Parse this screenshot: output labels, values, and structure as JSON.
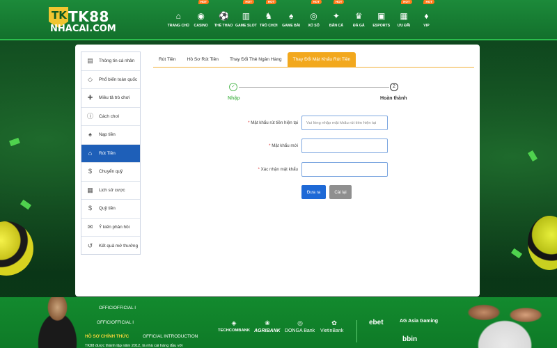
{
  "header": {
    "logo_badge": "TK",
    "logo_brand": "TK88",
    "logo_site": "NHACAI.COM",
    "hot_badge": "HOT",
    "nav": [
      {
        "label": "TRANG CHỦ",
        "icon": "home-icon",
        "hot": false
      },
      {
        "label": "CASINO",
        "icon": "casino-chip-icon",
        "hot": true
      },
      {
        "label": "THỂ THAO",
        "icon": "soccer-ball-icon",
        "hot": false
      },
      {
        "label": "GAME SLOT",
        "icon": "slot-machine-icon",
        "hot": true
      },
      {
        "label": "TRÒ CHƠI",
        "icon": "chess-icon",
        "hot": true
      },
      {
        "label": "GAME BÀI",
        "icon": "cards-icon",
        "hot": false
      },
      {
        "label": "XỔ SỐ",
        "icon": "lottery-ball-icon",
        "hot": true
      },
      {
        "label": "BẮN CÁ",
        "icon": "fish-icon",
        "hot": true
      },
      {
        "label": "ĐÁ GÀ",
        "icon": "rooster-icon",
        "hot": false
      },
      {
        "label": "ESPORTS",
        "icon": "gamepad-icon",
        "hot": false
      },
      {
        "label": "ƯU ĐÃI",
        "icon": "gift-icon",
        "hot": true
      },
      {
        "label": "VIP",
        "icon": "vip-icon",
        "hot": true
      }
    ]
  },
  "sidebar": {
    "items": [
      {
        "label": "Thông tin cá nhân",
        "icon": "id-card-icon",
        "glyph": "▤"
      },
      {
        "label": "Phổ biến toàn quốc",
        "icon": "diamond-icon",
        "glyph": "◇"
      },
      {
        "label": "Miêu tả trò chơi",
        "icon": "gamepad-icon",
        "glyph": "✚"
      },
      {
        "label": "Cách chơi",
        "icon": "info-icon",
        "glyph": "ⓘ"
      },
      {
        "label": "Nạp tiền",
        "icon": "piggy-bank-icon",
        "glyph": "♠"
      },
      {
        "label": "Rút Tiền",
        "icon": "bank-icon",
        "glyph": "⌂"
      },
      {
        "label": "Chuyển quỹ",
        "icon": "dollar-circle-icon",
        "glyph": "$"
      },
      {
        "label": "Lịch sử cược",
        "icon": "document-icon",
        "glyph": "▦"
      },
      {
        "label": "Quỹ tiền",
        "icon": "cash-icon",
        "glyph": "$"
      },
      {
        "label": "Ý kiến phản hồi",
        "icon": "chat-icon",
        "glyph": "✉"
      },
      {
        "label": "Kết quả mở thưởng",
        "icon": "history-icon",
        "glyph": "↺"
      }
    ],
    "active_index": 5
  },
  "tabs": [
    {
      "label": "Rút Tiền",
      "active": false
    },
    {
      "label": "Hồ Sơ Rút Tiền",
      "active": false
    },
    {
      "label": "Thay Đổi Thẻ Ngân Hàng",
      "active": false
    },
    {
      "label": "Thay Đổi Mật Khẩu Rút Tiền",
      "active": true
    }
  ],
  "stepper": {
    "step1_symbol": "✓",
    "step1_label": "Nhập",
    "step2_symbol": "2",
    "step2_label": "Hoàn thành"
  },
  "form": {
    "required_mark": "*",
    "current_password_label": "Mật khẩu rút tiền hiện tại",
    "current_password_placeholder": "Vui lòng nhập mật khẩu rút tiền hiện tại",
    "new_password_label": "Mật khẩu mới",
    "confirm_password_label": "Xác nhận mật khẩu",
    "submit_label": "Đưa ra",
    "reset_label": "Cài lại"
  },
  "footer": {
    "line1": "OFFICIOFFICIAL I",
    "line2": "OFFICIOFFICIAL I",
    "heading": "HỒ SƠ CHÍNH THỨC",
    "heading_sub": "OFFICIAL INTRODUCTION",
    "caption": "TK88 được thành lập năm 2012, là nhà cái hàng đầu với",
    "banks": [
      {
        "name": "TECHCOMBANK",
        "icon": "techcombank-logo-icon",
        "glyph": "◈"
      },
      {
        "name": "AGRIBANK",
        "icon": "agribank-logo-icon",
        "glyph": "❀"
      },
      {
        "name": "DONGA Bank",
        "icon": "dongabank-logo-icon",
        "glyph": "◎"
      },
      {
        "name": "VietinBank",
        "icon": "vietinbank-logo-icon",
        "glyph": "✿"
      }
    ],
    "partners": [
      {
        "name": "ebet",
        "icon": "ebet-logo-icon"
      },
      {
        "name": "AG Asia Gaming",
        "icon": "ag-logo-icon"
      },
      {
        "name": "bbin",
        "icon": "bbin-logo-icon"
      }
    ]
  },
  "colors": {
    "header_green": "#1c8a3a",
    "active_blue": "#1e5fb8",
    "tab_orange": "#f2a81d",
    "success_green": "#5cbd5e",
    "hot_orange": "#ff7a1a"
  }
}
